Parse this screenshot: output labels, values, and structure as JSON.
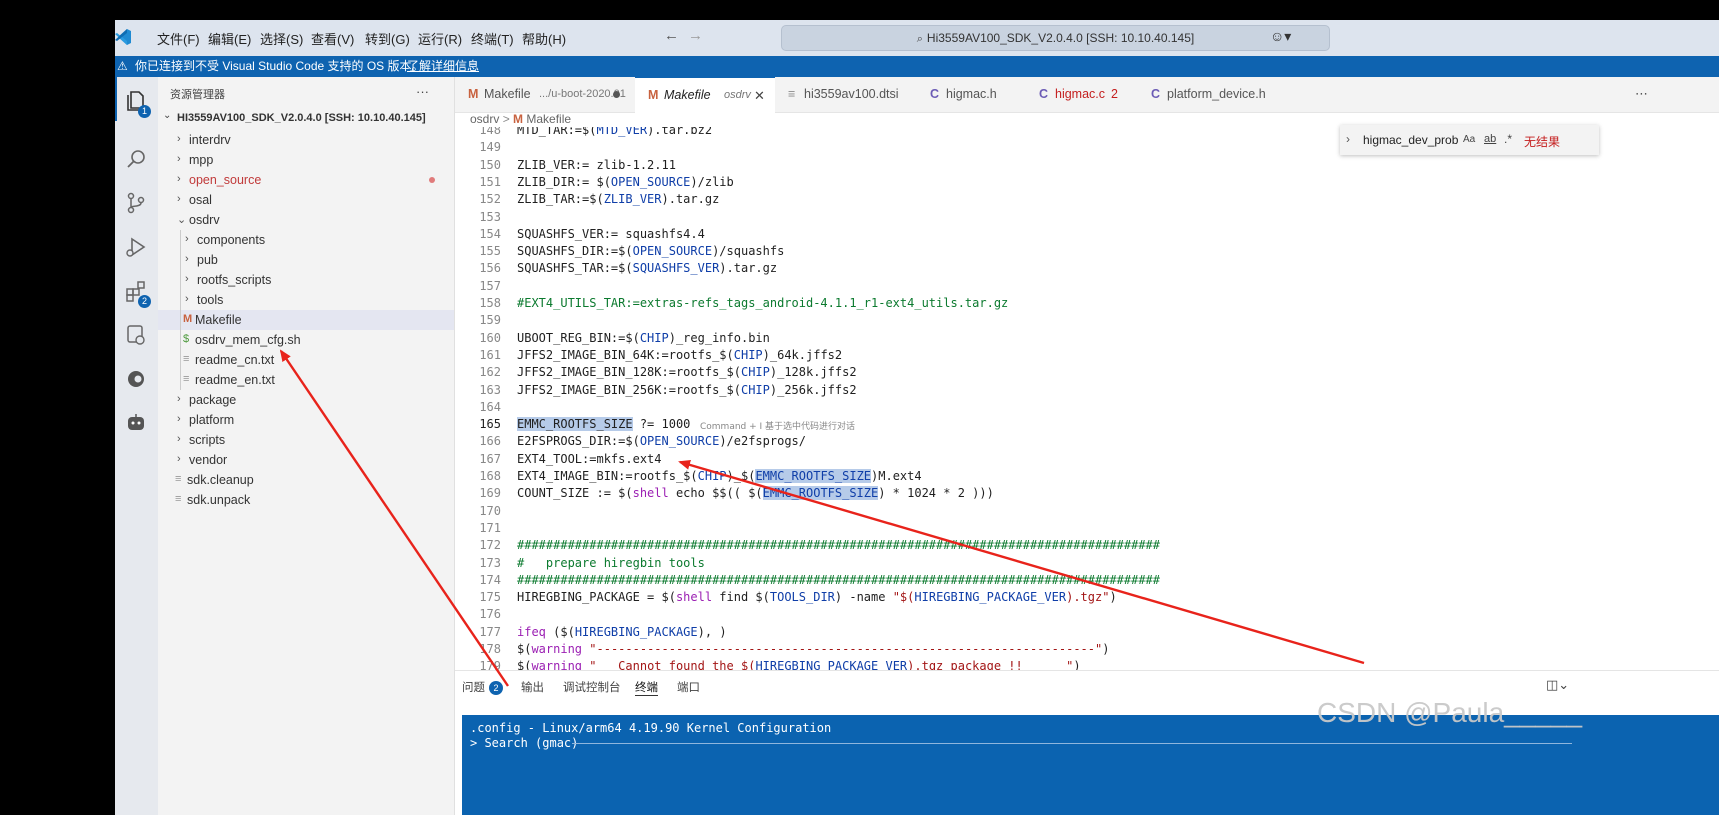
{
  "menu": [
    "文件(F)",
    "编辑(E)",
    "选择(S)",
    "查看(V)",
    "转到(G)",
    "运行(R)",
    "终端(T)",
    "帮助(H)"
  ],
  "search_title": "Hi3559AV100_SDK_V2.0.4.0 [SSH: 10.10.40.145]",
  "notice": {
    "text": "你已连接到不受 Visual Studio Code 支持的 OS 版本。",
    "link": "了解详细信息"
  },
  "activity_badges": {
    "explorer": "1",
    "extensions": "2"
  },
  "sidebar": {
    "title": "资源管理器",
    "more": "···",
    "root": "HI3559AV100_SDK_V2.0.4.0 [SSH: 10.10.40.145]",
    "items": [
      {
        "label": "interdrv",
        "type": "folder",
        "depth": 1
      },
      {
        "label": "mpp",
        "type": "folder",
        "depth": 1
      },
      {
        "label": "open_source",
        "type": "folder",
        "depth": 1,
        "modified": true
      },
      {
        "label": "osal",
        "type": "folder",
        "depth": 1
      },
      {
        "label": "osdrv",
        "type": "folder-open",
        "depth": 1
      },
      {
        "label": "components",
        "type": "folder",
        "depth": 2
      },
      {
        "label": "pub",
        "type": "folder",
        "depth": 2
      },
      {
        "label": "rootfs_scripts",
        "type": "folder",
        "depth": 2
      },
      {
        "label": "tools",
        "type": "folder",
        "depth": 2
      },
      {
        "label": "Makefile",
        "type": "makefile",
        "depth": 2,
        "selected": true
      },
      {
        "label": "osdrv_mem_cfg.sh",
        "type": "shell",
        "depth": 2
      },
      {
        "label": "readme_cn.txt",
        "type": "text",
        "depth": 2
      },
      {
        "label": "readme_en.txt",
        "type": "text",
        "depth": 2
      },
      {
        "label": "package",
        "type": "folder",
        "depth": 1
      },
      {
        "label": "platform",
        "type": "folder",
        "depth": 1
      },
      {
        "label": "scripts",
        "type": "folder",
        "depth": 1
      },
      {
        "label": "vendor",
        "type": "folder",
        "depth": 1
      },
      {
        "label": "sdk.cleanup",
        "type": "text",
        "depth": 1
      },
      {
        "label": "sdk.unpack",
        "type": "text",
        "depth": 1
      }
    ]
  },
  "tabs": [
    {
      "icon": "M",
      "name": "Makefile",
      "desc": ".../u-boot-2020.01",
      "dirty": true
    },
    {
      "icon": "M",
      "name": "Makefile",
      "desc": "osdrv",
      "active": true
    },
    {
      "icon": "≡",
      "name": "hi3559av100.dtsi"
    },
    {
      "icon": "C",
      "name": "higmac.h"
    },
    {
      "icon": "C",
      "name": "higmac.c",
      "count": "2",
      "error": true
    },
    {
      "icon": "C",
      "name": "platform_device.h"
    }
  ],
  "breadcrumb": {
    "folder": "osdrv",
    "file": "Makefile"
  },
  "find": {
    "query": "higmac_dev_prob",
    "opt_case": "Aa",
    "opt_word": "ab",
    "opt_regex": ".*",
    "result": "无结果"
  },
  "code_lines": [
    {
      "n": "148",
      "t": "MTD_TAR:=$(MTD_VER).tar.bz2"
    },
    {
      "n": "149",
      "t": ""
    },
    {
      "n": "150",
      "t": "ZLIB_VER:= zlib-1.2.11"
    },
    {
      "n": "151",
      "t": "ZLIB_DIR:= $(OPEN_SOURCE)/zlib"
    },
    {
      "n": "152",
      "t": "ZLIB_TAR:=$(ZLIB_VER).tar.gz"
    },
    {
      "n": "153",
      "t": ""
    },
    {
      "n": "154",
      "t": "SQUASHFS_VER:= squashfs4.4"
    },
    {
      "n": "155",
      "t": "SQUASHFS_DIR:=$(OPEN_SOURCE)/squashfs"
    },
    {
      "n": "156",
      "t": "SQUASHFS_TAR:=$(SQUASHFS_VER).tar.gz"
    },
    {
      "n": "157",
      "t": ""
    },
    {
      "n": "158",
      "t": "#EXT4_UTILS_TAR:=extras-refs_tags_android-4.1.1_r1-ext4_utils.tar.gz"
    },
    {
      "n": "159",
      "t": ""
    },
    {
      "n": "160",
      "t": "UBOOT_REG_BIN:=$(CHIP)_reg_info.bin"
    },
    {
      "n": "161",
      "t": "JFFS2_IMAGE_BIN_64K:=rootfs_$(CHIP)_64k.jffs2"
    },
    {
      "n": "162",
      "t": "JFFS2_IMAGE_BIN_128K:=rootfs_$(CHIP)_128k.jffs2"
    },
    {
      "n": "163",
      "t": "JFFS2_IMAGE_BIN_256K:=rootfs_$(CHIP)_256k.jffs2"
    },
    {
      "n": "164",
      "t": ""
    },
    {
      "n": "165",
      "t": "EMMC_ROOTFS_SIZE ?= 1000"
    },
    {
      "n": "166",
      "t": "E2FSPROGS_DIR:=$(OPEN_SOURCE)/e2fsprogs/"
    },
    {
      "n": "167",
      "t": "EXT4_TOOL:=mkfs.ext4"
    },
    {
      "n": "168",
      "t": "EXT4_IMAGE_BIN:=rootfs_$(CHIP)_$(EMMC_ROOTFS_SIZE)M.ext4"
    },
    {
      "n": "169",
      "t": "COUNT_SIZE := $(shell echo $$(( $(EMMC_ROOTFS_SIZE) * 1024 * 2 )))"
    },
    {
      "n": "170",
      "t": ""
    },
    {
      "n": "171",
      "t": ""
    },
    {
      "n": "172",
      "t": "#########################################################################################"
    },
    {
      "n": "173",
      "t": "#   prepare hiregbin tools"
    },
    {
      "n": "174",
      "t": "#########################################################################################"
    },
    {
      "n": "175",
      "t": "HIREGBING_PACKAGE = $(shell find $(TOOLS_DIR) -name \"$(HIREGBING_PACKAGE_VER).tgz\")"
    },
    {
      "n": "176",
      "t": ""
    },
    {
      "n": "177",
      "t": "ifeq ($(HIREGBING_PACKAGE), )"
    },
    {
      "n": "178",
      "t": "$(warning \"---------------------------------------------------------------------\")"
    },
    {
      "n": "179",
      "t": "$(warning \"   Cannot found the $(HIREGBING_PACKAGE_VER).tgz package !!      \")"
    }
  ],
  "inline_hint": "Command + I 基于选中代码进行对话",
  "panel_tabs": [
    {
      "label": "问题",
      "badge": "2"
    },
    {
      "label": "输出"
    },
    {
      "label": "调试控制台"
    },
    {
      "label": "终端",
      "active": true
    },
    {
      "label": "端口"
    }
  ],
  "terminal": {
    "line1": ".config - Linux/arm64 4.19.90 Kernel Configuration",
    "line2": "> Search (gmac)"
  },
  "watermark": "CSDN @Paula_____",
  "colors": {
    "notice_bg": "#0e63b0",
    "terminal_bg": "#0b63b0",
    "arrow": "#e8231b",
    "selection": "#b6cbe9"
  }
}
